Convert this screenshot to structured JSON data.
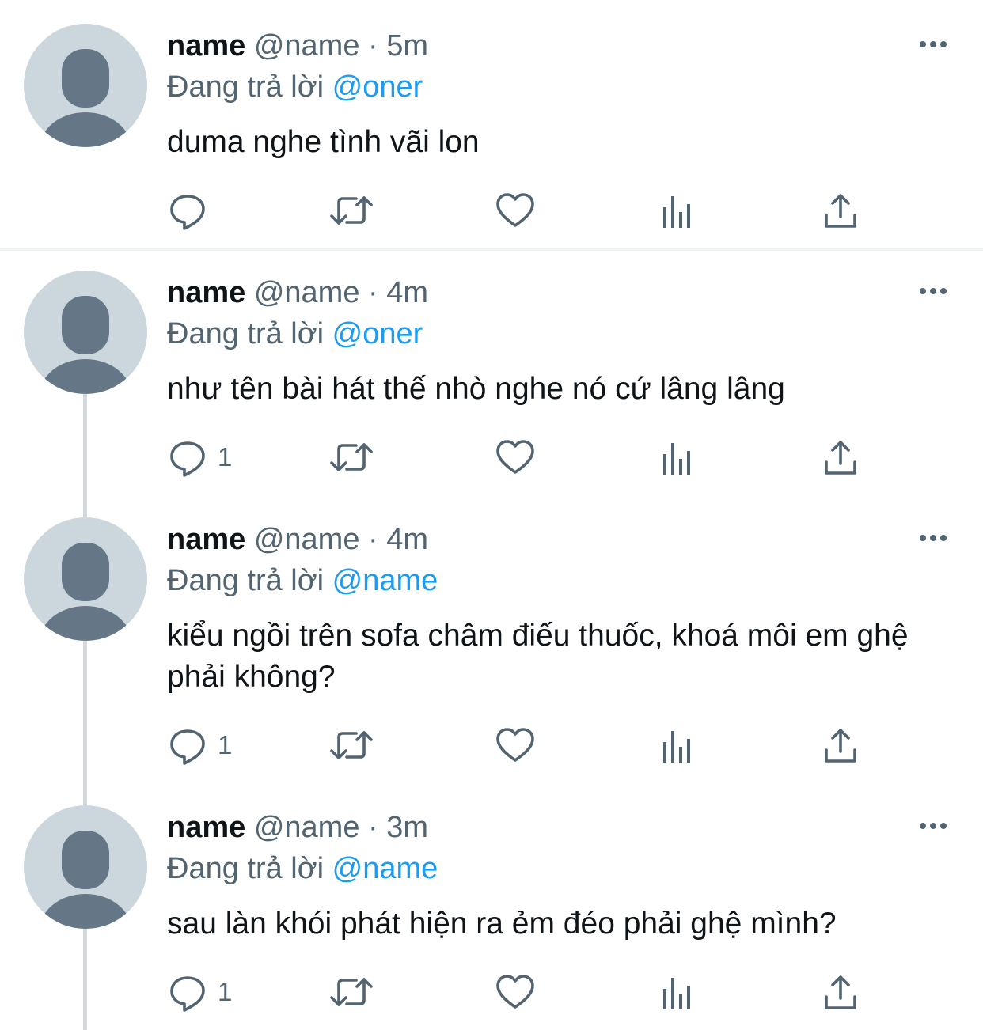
{
  "tweets": [
    {
      "name": "name",
      "handle": "@name",
      "sep": "·",
      "time": "5m",
      "reply_prefix": "Đang trả lời",
      "reply_to": "@oner",
      "text": "duma nghe tình vãi lon",
      "reply_count": ""
    },
    {
      "name": "name",
      "handle": "@name",
      "sep": "·",
      "time": "4m",
      "reply_prefix": "Đang trả lời",
      "reply_to": "@oner",
      "text": "như tên bài hát thế nhò nghe nó cứ lâng lâng",
      "reply_count": "1"
    },
    {
      "name": "name",
      "handle": "@name",
      "sep": "·",
      "time": "4m",
      "reply_prefix": "Đang trả lời",
      "reply_to": "@name",
      "text": "kiểu ngồi trên sofa châm điếu thuốc, khoá môi em ghệ phải không?",
      "reply_count": "1"
    },
    {
      "name": "name",
      "handle": "@name",
      "sep": "·",
      "time": "3m",
      "reply_prefix": "Đang trả lời",
      "reply_to": "@name",
      "text": "sau làn khói phát hiện ra ẻm đéo phải ghệ mình?",
      "reply_count": "1"
    }
  ],
  "icons": {
    "more": "more-horizontal-icon",
    "reply": "reply-bubble-icon",
    "retweet": "retweet-icon",
    "like": "heart-icon",
    "views": "analytics-bars-icon",
    "share": "share-upload-icon"
  },
  "colors": {
    "primary_text": "#0f1419",
    "secondary_text": "#536471",
    "mention": "#1d9bf0",
    "avatar_bg": "#ccd6dd",
    "avatar_fg": "#657786",
    "thread_line": "#cfd9de",
    "divider": "#eff3f4"
  }
}
